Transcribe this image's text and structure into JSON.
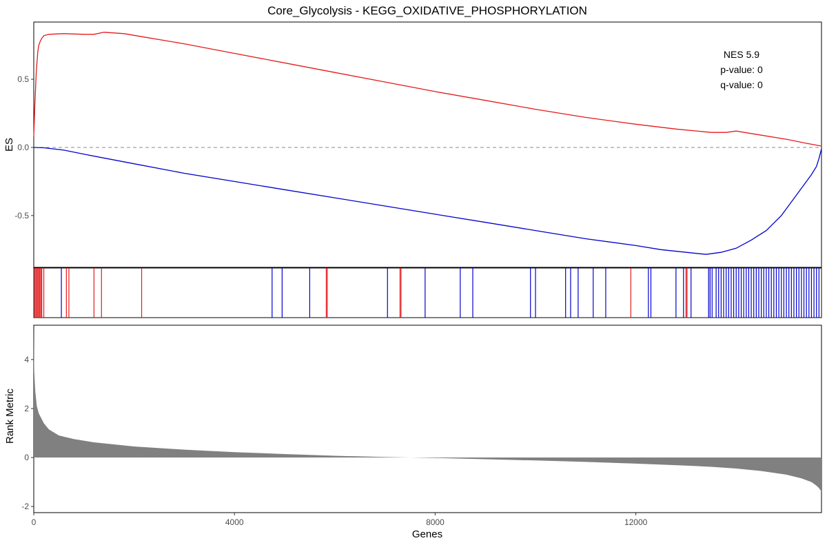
{
  "chart_data": {
    "type": "line",
    "title": "Core_Glycolysis - KEGG_OXIDATIVE_PHOSPHORYLATION",
    "x_axis": {
      "label": "Genes",
      "range": [
        0,
        15700
      ],
      "ticks": [
        0,
        4000,
        8000,
        12000
      ],
      "tick_labels": [
        "0",
        "4000",
        "8000",
        "12000"
      ]
    },
    "es_panel": {
      "ylabel": "ES",
      "ylim": [
        -0.88,
        0.92
      ],
      "ticks": [
        0.5,
        0.0,
        -0.5
      ],
      "tick_labels": [
        "0.5",
        "0.0",
        "-0.5"
      ],
      "reference_line": 0,
      "annotation": [
        "NES 5.9",
        "p-value: 0",
        "q-value: 0"
      ],
      "series": [
        {
          "color": "#e41a1c",
          "x": [
            0,
            20,
            50,
            80,
            100,
            130,
            160,
            200,
            300,
            600,
            1000,
            1200,
            1400,
            1800,
            2200,
            3000,
            4000,
            5000,
            6000,
            7000,
            8000,
            9000,
            10000,
            11000,
            12000,
            12800,
            13500,
            13800,
            14000,
            14500,
            15000,
            15400,
            15700
          ],
          "y": [
            0.08,
            0.3,
            0.55,
            0.7,
            0.75,
            0.78,
            0.8,
            0.82,
            0.83,
            0.835,
            0.83,
            0.83,
            0.845,
            0.835,
            0.81,
            0.76,
            0.69,
            0.62,
            0.55,
            0.48,
            0.41,
            0.345,
            0.28,
            0.22,
            0.17,
            0.135,
            0.11,
            0.11,
            0.12,
            0.09,
            0.06,
            0.03,
            0.01
          ]
        },
        {
          "color": "#0000cc",
          "x": [
            0,
            200,
            600,
            1000,
            2000,
            3000,
            4000,
            5000,
            6000,
            7000,
            8000,
            9000,
            10000,
            11000,
            12000,
            12500,
            13000,
            13400,
            13700,
            14000,
            14300,
            14600,
            14900,
            15100,
            15300,
            15500,
            15600,
            15650,
            15700
          ],
          "y": [
            0,
            -0.003,
            -0.02,
            -0.05,
            -0.12,
            -0.19,
            -0.25,
            -0.31,
            -0.37,
            -0.43,
            -0.49,
            -0.55,
            -0.61,
            -0.67,
            -0.72,
            -0.75,
            -0.77,
            -0.785,
            -0.77,
            -0.74,
            -0.68,
            -0.61,
            -0.5,
            -0.4,
            -0.3,
            -0.2,
            -0.14,
            -0.08,
            -0.01
          ]
        }
      ]
    },
    "hit_panel": {
      "red_hits": [
        20,
        40,
        60,
        80,
        100,
        120,
        140,
        160,
        200,
        650,
        700,
        1200,
        1350,
        2150,
        5830,
        5850,
        7300,
        7320,
        11900,
        13000,
        13020
      ],
      "blue_hits": [
        550,
        4750,
        4950,
        5500,
        7050,
        7800,
        8500,
        8750,
        9900,
        10000,
        10600,
        10700,
        10850,
        11150,
        11400,
        12250,
        12300,
        12800,
        12950,
        13100,
        13450,
        13480,
        13520,
        13600,
        13650,
        13700,
        13750,
        13800,
        13850,
        13900,
        13950,
        14000,
        14050,
        14100,
        14150,
        14200,
        14250,
        14300,
        14350,
        14400,
        14450,
        14500,
        14550,
        14600,
        14650,
        14700,
        14750,
        14800,
        14850,
        14900,
        14950,
        15000,
        15050,
        15100,
        15150,
        15200,
        15250,
        15300,
        15350,
        15400,
        15450,
        15500,
        15550,
        15600,
        15650
      ]
    },
    "rank_panel": {
      "ylabel": "Rank Metric",
      "ylim": [
        -2.25,
        5.4
      ],
      "ticks": [
        4,
        2,
        0,
        -2
      ],
      "tick_labels": [
        "4",
        "2",
        "0",
        "-2"
      ],
      "color": "#808080",
      "x": [
        0,
        5,
        10,
        30,
        60,
        100,
        200,
        300,
        500,
        800,
        1200,
        2000,
        3000,
        4000,
        5000,
        6000,
        7000,
        7500,
        8000,
        9000,
        10000,
        11000,
        12000,
        13000,
        13500,
        14000,
        14500,
        15000,
        15300,
        15500,
        15600,
        15650,
        15700
      ],
      "y": [
        5.3,
        4.0,
        3.5,
        2.7,
        2.1,
        1.8,
        1.4,
        1.15,
        0.9,
        0.75,
        0.62,
        0.45,
        0.32,
        0.22,
        0.14,
        0.07,
        0.02,
        0.0,
        -0.02,
        -0.07,
        -0.12,
        -0.18,
        -0.25,
        -0.33,
        -0.38,
        -0.45,
        -0.55,
        -0.7,
        -0.85,
        -1.0,
        -1.15,
        -1.25,
        -1.4
      ]
    }
  }
}
